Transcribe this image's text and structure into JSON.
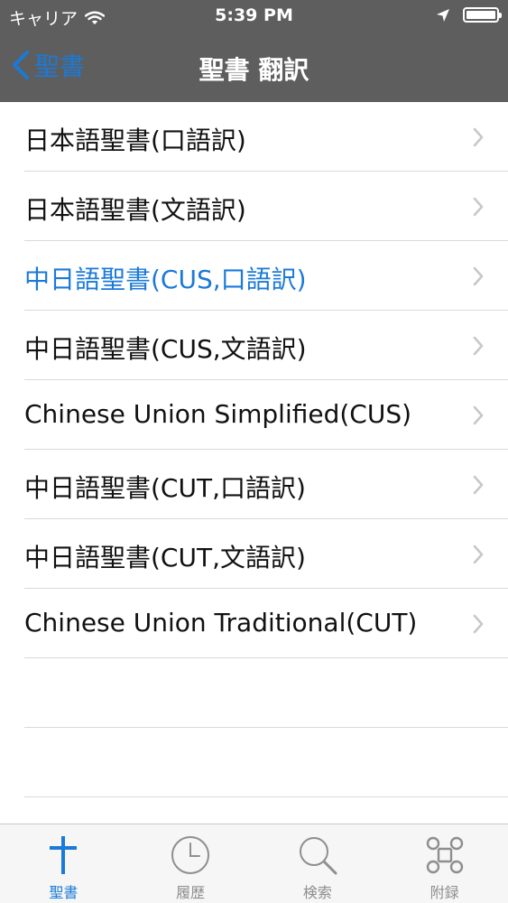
{
  "status_bar": {
    "carrier": "キャリア",
    "time": "5:39 PM"
  },
  "nav": {
    "back_label": "聖書",
    "title": "聖書 翻訳"
  },
  "colors": {
    "accent": "#1a7ad8",
    "bar": "#5e5e5e"
  },
  "translations": [
    {
      "label": "日本語聖書(口語訳)",
      "selected": false
    },
    {
      "label": "日本語聖書(文語訳)",
      "selected": false
    },
    {
      "label": "中日語聖書(CUS,口語訳)",
      "selected": true
    },
    {
      "label": "中日語聖書(CUS,文語訳)",
      "selected": false
    },
    {
      "label": "Chinese Union Simplified(CUS)",
      "selected": false
    },
    {
      "label": "中日語聖書(CUT,口語訳)",
      "selected": false
    },
    {
      "label": "中日語聖書(CUT,文語訳)",
      "selected": false
    },
    {
      "label": "Chinese Union Traditional(CUT)",
      "selected": false
    }
  ],
  "tabs": [
    {
      "label": "聖書",
      "icon": "cross-icon",
      "active": true
    },
    {
      "label": "履歴",
      "icon": "clock-icon",
      "active": false
    },
    {
      "label": "検索",
      "icon": "search-icon",
      "active": false
    },
    {
      "label": "附録",
      "icon": "command-icon",
      "active": false
    }
  ]
}
